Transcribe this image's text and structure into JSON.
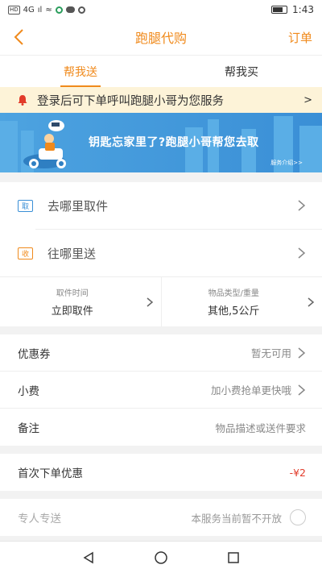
{
  "statusbar": {
    "left": [
      "HD",
      "4G",
      "ıl",
      "≈"
    ],
    "time": "1:43"
  },
  "header": {
    "title": "跑腿代购",
    "order_label": "订单"
  },
  "tabs": [
    {
      "label": "帮我送",
      "active": true
    },
    {
      "label": "帮我买",
      "active": false
    }
  ],
  "notice": {
    "text": "登录后可下单呼叫跑腿小哥为您服务",
    "arrow": ">"
  },
  "banner": {
    "headline": "钥匙忘家里了?跑腿小哥帮您去取",
    "sub": "服务介绍>>"
  },
  "addresses": [
    {
      "tag": "取",
      "text": "去哪里取件"
    },
    {
      "tag": "收",
      "text": "往哪里送"
    }
  ],
  "meta": [
    {
      "label": "取件时间",
      "value": "立即取件"
    },
    {
      "label": "物品类型/重量",
      "value": "其他,5公斤"
    }
  ],
  "options": {
    "coupon": {
      "label": "优惠券",
      "value": "暂无可用"
    },
    "tip": {
      "label": "小费",
      "value": "加小费抢单更快哦"
    },
    "note": {
      "label": "备注",
      "placeholder": "物品描述或送件要求"
    }
  },
  "first_order": {
    "label": "首次下单优惠",
    "value": "-¥2"
  },
  "dedicated": {
    "label": "专人专送",
    "value": "本服务当前暂不开放"
  },
  "colors": {
    "accent": "#f08a1c",
    "banner": "#3a8fd6",
    "notice_bg": "#fdf3d8",
    "discount": "#e23b2a"
  }
}
